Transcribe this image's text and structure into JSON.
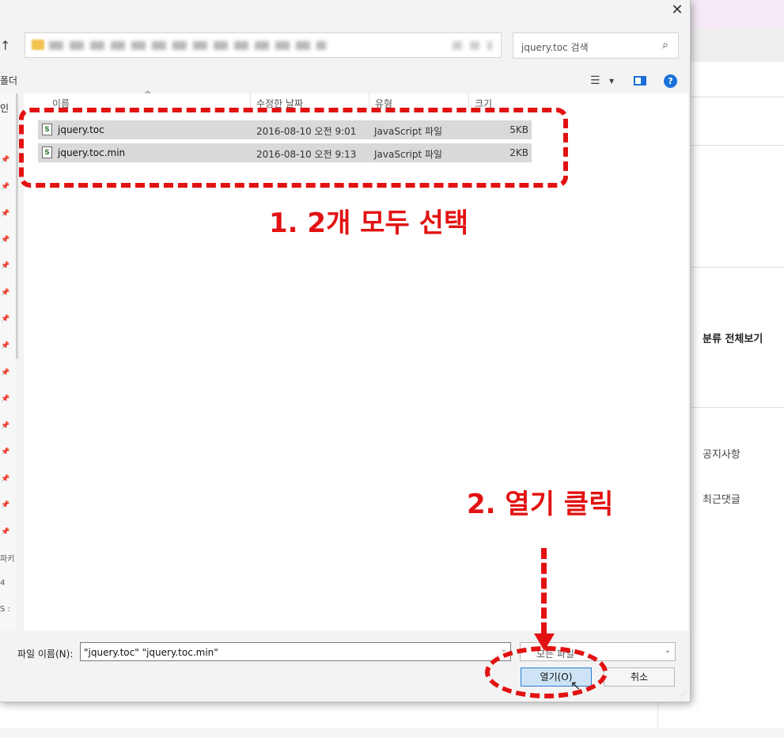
{
  "background_page": {
    "sidebar_heading": "분류 전체보기",
    "links": [
      "공지사항",
      "최근댓글"
    ]
  },
  "dialog": {
    "close_glyph": "✕",
    "up_glyph": "↑",
    "search_placeholder": "jquery.toc 검색",
    "commandbar_label": "폴더",
    "nav_first_label": "인",
    "nav_bottom_labels": [
      "파키",
      "4",
      "S :"
    ],
    "columns": [
      "이름",
      "수정한 날짜",
      "유형",
      "크기"
    ],
    "files": [
      {
        "name": "jquery.toc",
        "date": "2016-08-10 오전 9:01",
        "type": "JavaScript 파일",
        "size": "5KB"
      },
      {
        "name": "jquery.toc.min",
        "date": "2016-08-10 오전 9:13",
        "type": "JavaScript 파일",
        "size": "2KB"
      }
    ],
    "filename_label": "파일 이름(N):",
    "filename_value": "\"jquery.toc\" \"jquery.toc.min\"",
    "filetype_value": "모든 파일",
    "open_button": "열기(O)",
    "cancel_button": "취소"
  },
  "annotations": {
    "step1": "1. 2개 모두 선택",
    "step2": "2. 열기 클릭",
    "color": "#e21212"
  },
  "colors": {
    "selection": "#d9d9d9",
    "primary_button_bg": "#cfe3f7",
    "primary_button_border": "#2b7bd1",
    "help_icon": "#1a73d9"
  }
}
